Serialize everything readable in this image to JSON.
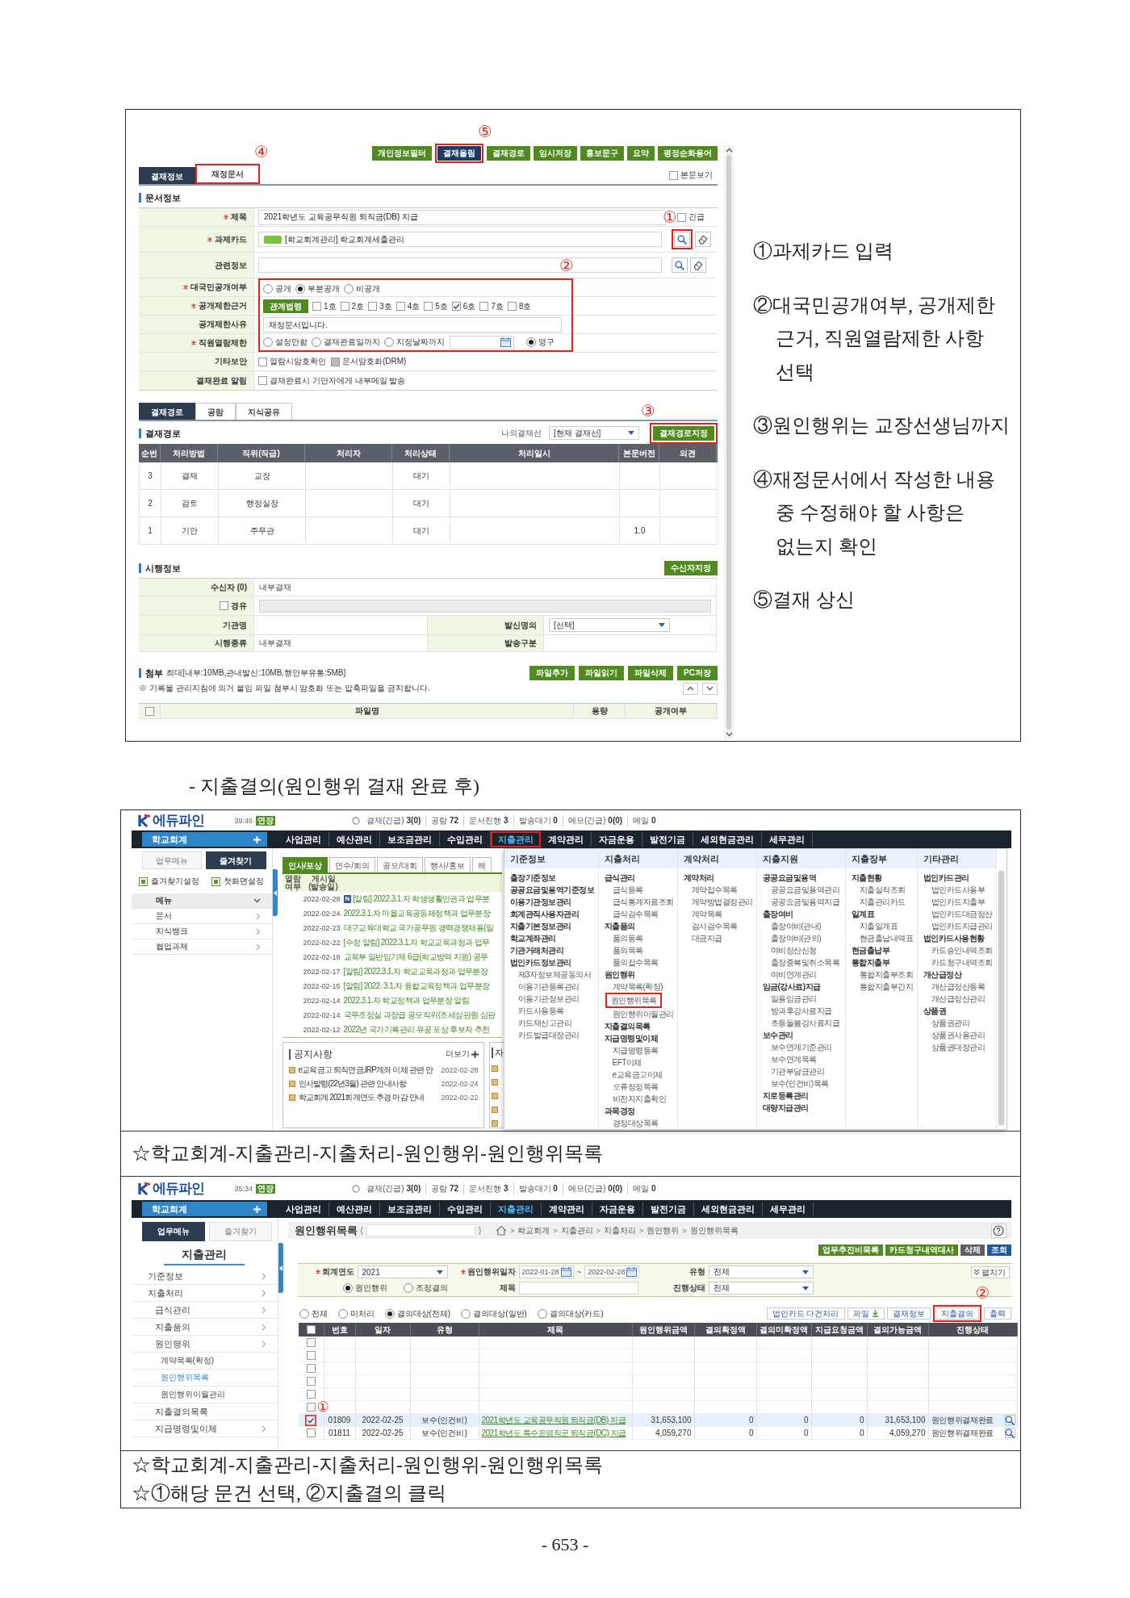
{
  "approval_screen": {
    "toolbar": [
      {
        "label": "개인정보필터",
        "selected": false,
        "highlighted": false
      },
      {
        "label": "결재올림",
        "selected": true,
        "highlighted": true,
        "marker": "⑤"
      },
      {
        "label": "결재경로",
        "selected": false,
        "highlighted": false
      },
      {
        "label": "임시저장",
        "selected": false,
        "highlighted": false
      },
      {
        "label": "홍보문구",
        "selected": false,
        "highlighted": false
      },
      {
        "label": "요약",
        "selected": false,
        "highlighted": false
      },
      {
        "label": "평정순화용어",
        "selected": false,
        "highlighted": false
      }
    ],
    "tabs": [
      {
        "label": "결재정보",
        "selected": true,
        "highlighted": false
      },
      {
        "label": "재정문서",
        "selected": false,
        "highlighted": true,
        "marker": "④"
      }
    ],
    "body_view": {
      "label": "본문보기",
      "checked": false
    },
    "doc_info": {
      "title": "문서정보",
      "rows": [
        {
          "kind": "text",
          "label": "제목",
          "required": true,
          "highlighted": false,
          "value": "2021학년도 교육공무직원 퇴직금(DB) 지급",
          "urgent": {
            "label": "긴급",
            "checked": false
          }
        },
        {
          "kind": "lookup",
          "label": "과제카드",
          "required": true,
          "highlighted": false,
          "tagged": true,
          "value": "[학교회계관리] 학교회계세출관리",
          "search_highlighted": true,
          "marker": "①"
        },
        {
          "kind": "lookup",
          "label": "관련정보",
          "required": false,
          "highlighted": false,
          "tagged": false,
          "search_highlighted": false
        },
        {
          "kind": "radios",
          "label": "대국민공개여부",
          "required": true,
          "highlighted": true,
          "marker": "②",
          "options": [
            {
              "label": "공개",
              "selected": false,
              "date_field": false
            },
            {
              "label": "부분공개",
              "selected": true,
              "date_field": false
            },
            {
              "label": "비공개",
              "selected": false,
              "date_field": false
            }
          ]
        },
        {
          "kind": "checks",
          "label": "공개제한근거",
          "required": true,
          "highlighted": true,
          "button": "관계법령",
          "options": [
            {
              "label": "1호",
              "checked": false,
              "disabled": false
            },
            {
              "label": "2호",
              "checked": false,
              "disabled": false
            },
            {
              "label": "3호",
              "checked": false,
              "disabled": false
            },
            {
              "label": "4호",
              "checked": false,
              "disabled": false
            },
            {
              "label": "5호",
              "checked": false,
              "disabled": false
            },
            {
              "label": "6호",
              "checked": true,
              "disabled": false
            },
            {
              "label": "7호",
              "checked": false,
              "disabled": false
            },
            {
              "label": "8호",
              "checked": false,
              "disabled": false
            }
          ]
        },
        {
          "kind": "input",
          "label": "공개제한사유",
          "required": false,
          "highlighted": true,
          "value": "재정문서입니다."
        },
        {
          "kind": "radios",
          "label": "직원열람제한",
          "required": true,
          "highlighted": true,
          "options": [
            {
              "label": "설정안함",
              "selected": false,
              "date_field": false
            },
            {
              "label": "결재완료일까지",
              "selected": false,
              "date_field": false
            },
            {
              "label": "지정날짜까지",
              "selected": false,
              "date_field": true
            },
            {
              "label": "영구",
              "selected": true,
              "date_field": false
            }
          ]
        },
        {
          "kind": "checks",
          "label": "기타보안",
          "required": false,
          "highlighted": false,
          "options": [
            {
              "label": "열람시암호확인",
              "checked": false,
              "disabled": false
            },
            {
              "label": "문서암호화(DRM)",
              "checked": false,
              "disabled": true
            }
          ]
        },
        {
          "kind": "checks",
          "label": "결재완료 알림",
          "required": false,
          "highlighted": false,
          "options": [
            {
              "label": "결재완료시 기안자에게 내부메일 발송",
              "checked": false,
              "disabled": false
            }
          ]
        }
      ]
    },
    "approval_tabs": [
      {
        "label": "결재경로",
        "selected": true
      },
      {
        "label": "공람",
        "selected": false
      },
      {
        "label": "지식공유",
        "selected": false
      }
    ],
    "approval_line": {
      "title": "결재경로",
      "my_line_label": "나의결재선",
      "my_line_value": "[현재 결재선]",
      "assign_button": {
        "label": "결재경로지정",
        "highlighted": true,
        "marker": "③"
      },
      "columns": [
        "순번",
        "처리방법",
        "직위(직급)",
        "처리자",
        "처리상태",
        "처리일시",
        "본문버전",
        "의견"
      ],
      "rows": [
        [
          "3",
          "결재",
          "교장",
          null,
          "대기",
          null,
          null,
          null
        ],
        [
          "2",
          "검토",
          "행정실장",
          null,
          "대기",
          null,
          null,
          null
        ],
        [
          "1",
          "기안",
          "주무관",
          null,
          "대기",
          null,
          "1.0",
          null
        ]
      ]
    },
    "enforcement": {
      "title": "시행정보",
      "button": "수신자지정",
      "rows": [
        {
          "kind": "single",
          "label": "수신자 (0)",
          "value": "내부결재"
        },
        {
          "kind": "via",
          "label": "경유",
          "checked": false
        },
        {
          "kind": "pair",
          "cells": [
            {
              "label": "기관명"
            },
            {
              "label": "발신명의",
              "select": "[선택]"
            }
          ]
        },
        {
          "kind": "pair",
          "cells": [
            {
              "label": "시행종류",
              "value": "내부결재"
            },
            {
              "label": "발송구분"
            }
          ]
        }
      ]
    },
    "attachments": {
      "title": "첨부",
      "limit": "최대[내부:10MB,관내발신:10MB,행안부유통:5MB]",
      "buttons": [
        "파일추가",
        "파일읽기",
        "파일삭제",
        "PC저장"
      ],
      "notice": "※ 기록물 관리지침에 의거 붙임 파일 첨부시 암호화 또는 압축파일을 금지합니다.",
      "select_all": false,
      "columns": [
        "파일명",
        "용량",
        "공개여부"
      ]
    }
  },
  "approval_notes": [
    "①과제카드 입력",
    "②대국민공개여부, 공개제한\n근거, 직원열람제한 사항\n선택",
    "③원인행위는 교장선생님까지",
    "④재정문서에서 작성한 내용\n중 수정해야 할 사항은\n없는지 확인",
    "⑤결재 상신"
  ],
  "section_caption": "- 지출결의(원인행위 결재 완료 후)",
  "menu_screen": {
    "header": {
      "logo": "에듀파인",
      "time": "39:46",
      "badge": "연장",
      "status": [
        {
          "label": "결재(긴급)",
          "value": "3(0)"
        },
        {
          "label": "공람",
          "value": "72"
        },
        {
          "label": "문서진행",
          "value": "3"
        },
        {
          "label": "발송대기",
          "value": "0"
        },
        {
          "label": "메모(긴급)",
          "value": "0(0)"
        },
        {
          "label": "메일",
          "value": "0"
        }
      ]
    },
    "module": "학교회계",
    "nav": [
      {
        "label": "사업관리",
        "selected": false,
        "highlighted": false
      },
      {
        "label": "예산관리",
        "selected": false,
        "highlighted": false
      },
      {
        "label": "보조금관리",
        "selected": false,
        "highlighted": false
      },
      {
        "label": "수입관리",
        "selected": false,
        "highlighted": false
      },
      {
        "label": "지출관리",
        "selected": true,
        "highlighted": true
      },
      {
        "label": "계약관리",
        "selected": false,
        "highlighted": false
      },
      {
        "label": "자금운용",
        "selected": false,
        "highlighted": false
      },
      {
        "label": "발전기금",
        "selected": false,
        "highlighted": false
      },
      {
        "label": "세외현금관리",
        "selected": false,
        "highlighted": false
      },
      {
        "label": "세무관리",
        "selected": false,
        "highlighted": false
      }
    ],
    "sidebar": {
      "tabs": [
        {
          "label": "업무메뉴",
          "selected": false
        },
        {
          "label": "즐겨찾기",
          "selected": true
        }
      ],
      "shortcuts": [
        "즐겨찾기설정",
        "첫화면설정"
      ],
      "menu": [
        {
          "label": "메뉴",
          "expanded": true
        },
        {
          "label": "문서",
          "expanded": false
        },
        {
          "label": "지식뱅크",
          "expanded": false
        },
        {
          "label": "협업과제",
          "expanded": false
        }
      ]
    },
    "board": {
      "tabs": [
        {
          "label": "인사/포상",
          "selected": true
        },
        {
          "label": "연수/회의",
          "selected": false
        },
        {
          "label": "공모/대회",
          "selected": false
        },
        {
          "label": "행사/홍보",
          "selected": false
        },
        {
          "label": "해",
          "selected": false
        }
      ],
      "columns": [
        "열람 여부",
        "게시일 (발송일)"
      ],
      "rows": [
        {
          "date": "2022-02-28",
          "badge": "N",
          "title": "[알림] 2022.3.1.자 학생생활인권과 업무분"
        },
        {
          "date": "2022-02-24",
          "title": "2022.3.1.자 마을교육공동체정책과 업무분장"
        },
        {
          "date": "2022-02-23",
          "title": "대구교육대학교 국가공무원 경력경쟁채용(일"
        },
        {
          "date": "2022-02-22",
          "title": "[수정 알림] 2022.3.1.자 학교교육과정과 업무"
        },
        {
          "date": "2022-02-18",
          "title": "교육부 일반임기제 6급(학교방역 지원) 공무"
        },
        {
          "date": "2022-02-17",
          "title": "[알림] 2022.3.1.자 학교교육과정과 업무분장"
        },
        {
          "date": "2022-02-15",
          "title": "[알림] 2022. 3.1.자 융합교육정책과 업무분장"
        },
        {
          "date": "2022-02-14",
          "title": "2022.3.1.자 학교정책과 업무분장 알림"
        },
        {
          "date": "2022-02-14",
          "title": "국무조정실 과장급 공모직위(조세심판원 심판"
        },
        {
          "date": "2022-02-12",
          "title": "2022년 국가기록관리 유공 포상 후보자 추천"
        }
      ]
    },
    "notices": {
      "title": "공지사항",
      "more": "더보기",
      "items": [
        {
          "title": "e교육금고 퇴직연금,IRP계좌 이체 관련 안",
          "date": "2022-02-28"
        },
        {
          "title": "인사발령(22년3월) 관련 안내사항",
          "date": "2022-02-24"
        },
        {
          "title": "학교회계 2021회계연도 추경 마감 안내",
          "date": "2022-02-22"
        }
      ]
    },
    "side_panel": {
      "title": "자"
    },
    "mega_menu": {
      "columns": [
        {
          "title": "기준정보",
          "items": [
            {
              "label": "출장기준정보",
              "highlighted": false
            },
            {
              "label": "공공요금및용역기준정보",
              "highlighted": false
            },
            {
              "label": "이용기관정보관리",
              "highlighted": false
            },
            {
              "label": "회계관직사용자관리",
              "highlighted": false
            },
            {
              "label": "지출기본정보관리",
              "highlighted": false
            },
            {
              "label": "학교계좌관리",
              "highlighted": false
            },
            {
              "label": "기관거래처관리",
              "highlighted": false
            },
            {
              "label": "법인카드정보관리",
              "highlighted": false,
              "children": [
                {
                  "label": "제3자정보제공동의서",
                  "highlighted": false
                },
                {
                  "label": "이용기관등록관리",
                  "highlighted": false
                },
                {
                  "label": "이용기관정보관리",
                  "highlighted": false
                },
                {
                  "label": "카드사용등록",
                  "highlighted": false
                },
                {
                  "label": "카드재신고관리",
                  "highlighted": false
                },
                {
                  "label": "카드발급대장관리",
                  "highlighted": false
                }
              ]
            }
          ]
        },
        {
          "title": "지출처리",
          "items": [
            {
              "label": "급식관리",
              "highlighted": false,
              "children": [
                {
                  "label": "급식등록",
                  "highlighted": false
                },
                {
                  "label": "급식통계자료조회",
                  "highlighted": false
                },
                {
                  "label": "급식검수목록",
                  "highlighted": false
                }
              ]
            },
            {
              "label": "지출품의",
              "highlighted": false,
              "children": [
                {
                  "label": "품의등록",
                  "highlighted": false
                },
                {
                  "label": "품의목록",
                  "highlighted": false
                },
                {
                  "label": "품의접수목록",
                  "highlighted": false
                }
              ]
            },
            {
              "label": "원인행위",
              "highlighted": false,
              "children": [
                {
                  "label": "계약목록(확정)",
                  "highlighted": false
                },
                {
                  "label": "원인행위목록",
                  "highlighted": true
                },
                {
                  "label": "원인행위이월관리",
                  "highlighted": false
                }
              ]
            },
            {
              "label": "지출결의목록",
              "highlighted": false
            },
            {
              "label": "지급명령및이체",
              "highlighted": false,
              "children": [
                {
                  "label": "지급명령등록",
                  "highlighted": false
                },
                {
                  "label": "EFT이체",
                  "highlighted": false
                },
                {
                  "label": "e교육금고이체",
                  "highlighted": false
                },
                {
                  "label": "오류정정목록",
                  "highlighted": false
                },
                {
                  "label": "비전자지출확인",
                  "highlighted": false
                }
              ]
            },
            {
              "label": "과목경정",
              "highlighted": false,
              "children": [
                {
                  "label": "경정대상목록",
                  "highlighted": false
                }
              ]
            }
          ]
        },
        {
          "title": "계약처리",
          "items": [
            {
              "label": "계약처리",
              "highlighted": false,
              "children": [
                {
                  "label": "계약접수목록",
                  "highlighted": false
                },
                {
                  "label": "계약방법결정관리",
                  "highlighted": false
                },
                {
                  "label": "계약목록",
                  "highlighted": false
                },
                {
                  "label": "검사검수목록",
                  "highlighted": false
                },
                {
                  "label": "대금지급",
                  "highlighted": false
                }
              ]
            }
          ]
        },
        {
          "title": "지출지원",
          "items": [
            {
              "label": "공공요금및용역",
              "highlighted": false,
              "children": [
                {
                  "label": "공공요금및용역관리",
                  "highlighted": false
                },
                {
                  "label": "공공요금및용역지급",
                  "highlighted": false
                }
              ]
            },
            {
              "label": "출장여비",
              "highlighted": false,
              "children": [
                {
                  "label": "출장여비(관내)",
                  "highlighted": false
                },
                {
                  "label": "출장여비(관외)",
                  "highlighted": false
                },
                {
                  "label": "여비정산신청",
                  "highlighted": false
                },
                {
                  "label": "출장중복및취소목록",
                  "highlighted": false
                },
                {
                  "label": "여비연계관리",
                  "highlighted": false
                }
              ]
            },
            {
              "label": "임금(강사료)지급",
              "highlighted": false,
              "children": [
                {
                  "label": "일용임금관리",
                  "highlighted": false
                },
                {
                  "label": "방과후강사료지급",
                  "highlighted": false
                },
                {
                  "label": "초등돌봄강사료지급",
                  "highlighted": false
                }
              ]
            },
            {
              "label": "보수관리",
              "highlighted": false,
              "children": [
                {
                  "label": "보수연계기준관리",
                  "highlighted": false
                },
                {
                  "label": "보수연계목록",
                  "highlighted": false
                },
                {
                  "label": "기관부담금관리",
                  "highlighted": false
                },
                {
                  "label": "보수(인건비)목록",
                  "highlighted": false
                }
              ]
            },
            {
              "label": "지로등록관리",
              "highlighted": false
            },
            {
              "label": "대량지급관리",
              "highlighted": false
            }
          ]
        },
        {
          "title": "지출장부",
          "items": [
            {
              "label": "지출현황",
              "highlighted": false,
              "children": [
                {
                  "label": "지출실적조회",
                  "highlighted": false
                },
                {
                  "label": "지출관리카드",
                  "highlighted": false
                }
              ]
            },
            {
              "label": "일계표",
              "highlighted": false,
              "children": [
                {
                  "label": "지출일계표",
                  "highlighted": false
                },
                {
                  "label": "현금출납내역표",
                  "highlighted": false
                }
              ]
            },
            {
              "label": "현금출납부",
              "highlighted": false
            },
            {
              "label": "통합지출부",
              "highlighted": false,
              "children": [
                {
                  "label": "통합지출부조회",
                  "highlighted": false
                },
                {
                  "label": "통합지출부간지",
                  "highlighted": false
                }
              ]
            }
          ]
        },
        {
          "title": "기타관리",
          "items": [
            {
              "label": "법인카드관리",
              "highlighted": false,
              "children": [
                {
                  "label": "법인카드사용부",
                  "highlighted": false
                },
                {
                  "label": "법인카드지출부",
                  "highlighted": false
                },
                {
                  "label": "법인카드대금정산",
                  "highlighted": false
                },
                {
                  "label": "법인카드지급관리",
                  "highlighted": false
                }
              ]
            },
            {
              "label": "법인카드사용현황",
              "highlighted": false,
              "children": [
                {
                  "label": "카드승인내역조회",
                  "highlighted": false
                },
                {
                  "label": "카드청구내역조회",
                  "highlighted": false
                }
              ]
            },
            {
              "label": "개산급정산",
              "highlighted": false,
              "children": [
                {
                  "label": "개산급정산등록",
                  "highlighted": false
                },
                {
                  "label": "개산급정산관리",
                  "highlighted": false
                }
              ]
            },
            {
              "label": "상품권",
              "highlighted": false,
              "children": [
                {
                  "label": "상품권관리",
                  "highlighted": false
                },
                {
                  "label": "상품권사용관리",
                  "highlighted": false
                },
                {
                  "label": "상품권대장관리",
                  "highlighted": false
                }
              ]
            }
          ]
        }
      ]
    }
  },
  "menu_screen_caption": "☆학교회계-지출관리-지출처리-원인행위-원인행위목록",
  "list_screen": {
    "header": {
      "logo": "에듀파인",
      "time": "35:34",
      "badge": "연장",
      "status": [
        {
          "label": "결재(긴급)",
          "value": "3(0)"
        },
        {
          "label": "공람",
          "value": "72"
        },
        {
          "label": "문서진행",
          "value": "3"
        },
        {
          "label": "발송대기",
          "value": "0"
        },
        {
          "label": "메모(긴급)",
          "value": "0(0)"
        },
        {
          "label": "메일",
          "value": "0"
        }
      ]
    },
    "module": "학교회계",
    "nav": [
      {
        "label": "사업관리",
        "selected": false,
        "highlighted": false
      },
      {
        "label": "예산관리",
        "selected": false,
        "highlighted": false
      },
      {
        "label": "보조금관리",
        "selected": false,
        "highlighted": false
      },
      {
        "label": "수입관리",
        "selected": false,
        "highlighted": false
      },
      {
        "label": "지출관리",
        "selected": true,
        "highlighted": false
      },
      {
        "label": "계약관리",
        "selected": false,
        "highlighted": false
      },
      {
        "label": "자금운용",
        "selected": false,
        "highlighted": false
      },
      {
        "label": "발전기금",
        "selected": false,
        "highlighted": false
      },
      {
        "label": "세외현금관리",
        "selected": false,
        "highlighted": false
      },
      {
        "label": "세무관리",
        "selected": false,
        "highlighted": false
      }
    ],
    "sidebar": {
      "tabs": [
        {
          "label": "업무메뉴",
          "selected": true
        },
        {
          "label": "즐겨찾기",
          "selected": false
        }
      ],
      "title": "지출관리",
      "menu": [
        {
          "label": "기준정보",
          "expandable": true,
          "selected": false
        },
        {
          "label": "지출처리",
          "expandable": true,
          "selected": false,
          "children": [
            {
              "label": "급식관리",
              "expandable": true,
              "selected": false
            },
            {
              "label": "지출품의",
              "expandable": true,
              "selected": false
            },
            {
              "label": "원인행위",
              "expandable": true,
              "selected": false,
              "children": [
                {
                  "label": "계약목록(확정)",
                  "expandable": false,
                  "selected": false
                },
                {
                  "label": "원인행위목록",
                  "expandable": false,
                  "selected": true
                },
                {
                  "label": "원인행위이월관리",
                  "expandable": false,
                  "selected": false
                }
              ]
            },
            {
              "label": "지출결의목록",
              "expandable": false,
              "selected": false
            },
            {
              "label": "지급명령및이체",
              "expandable": true,
              "selected": false
            }
          ]
        }
      ]
    },
    "page": {
      "title": "원인행위목록",
      "paren_open": "(",
      "paren_close": ")",
      "breadcrumb_separator": ">",
      "breadcrumb": [
        "학교회계",
        "지출관리",
        "지출처리",
        "원인행위",
        "원인행위목록"
      ]
    },
    "actions": [
      {
        "label": "업무추진비목록",
        "kind": "green"
      },
      {
        "label": "카드청구내역대사",
        "kind": "green"
      },
      {
        "label": "삭제",
        "kind": "grey"
      },
      {
        "label": "조회",
        "kind": "blue"
      }
    ],
    "filter": {
      "toggle": "펼치기",
      "cells": [
        {
          "kind": "select",
          "label": "회계연도",
          "required": true,
          "value": "2021"
        },
        {
          "kind": "date_range",
          "label": "원인행위일자",
          "required": true,
          "from": "2022-01-28",
          "separator": "~",
          "to": "2022-02-28"
        },
        {
          "kind": "select",
          "label": "유형",
          "required": false,
          "value": "전체"
        },
        {
          "kind": "radios",
          "options": [
            {
              "label": "원인행위",
              "selected": true
            },
            {
              "label": "조정결의",
              "selected": false
            }
          ]
        },
        {
          "kind": "input",
          "label": "제목",
          "required": false
        },
        {
          "kind": "select",
          "label": "진행상태",
          "required": false,
          "value": "전체"
        }
      ]
    },
    "scope": [
      {
        "label": "전체",
        "selected": false
      },
      {
        "label": "미처리",
        "selected": false
      },
      {
        "label": "결의대상(전체)",
        "selected": true
      },
      {
        "label": "결의대상(일반)",
        "selected": false
      },
      {
        "label": "결의대상(카드)",
        "selected": false
      }
    ],
    "tools": [
      {
        "label": "법인카드 다건처리",
        "icon": false,
        "highlighted": false
      },
      {
        "label": "파일",
        "icon": true,
        "highlighted": false
      },
      {
        "label": "결재정보",
        "icon": false,
        "highlighted": false
      },
      {
        "label": "지출결의",
        "icon": false,
        "highlighted": true,
        "marker": "②"
      },
      {
        "label": "출력",
        "icon": false,
        "highlighted": false
      }
    ],
    "table": {
      "select_all": false,
      "columns": [
        "번호",
        "일자",
        "유형",
        "제목",
        "원인행위금액",
        "결의확정액",
        "결의미확정액",
        "지급요청금액",
        "결의가능금액",
        "진행상태"
      ],
      "rows": [
        {
          "checked": false,
          "selected": false,
          "highlighted": false
        },
        {
          "checked": false,
          "selected": false,
          "highlighted": false
        },
        {
          "checked": false,
          "selected": false,
          "highlighted": false
        },
        {
          "checked": false,
          "selected": false,
          "highlighted": false
        },
        {
          "checked": false,
          "selected": false,
          "highlighted": false
        },
        {
          "checked": false,
          "selected": false,
          "highlighted": false
        },
        {
          "checked": true,
          "selected": true,
          "highlighted": true,
          "marker": "①",
          "cells": [
            "01809",
            "2022-02-25",
            "보수(인건비)",
            "2021학년도 교육공무직원 퇴직금(DB) 지급",
            "31,653,100",
            "0",
            "0",
            "0",
            "31,653,100",
            "원인행위결재완료"
          ]
        },
        {
          "checked": false,
          "selected": false,
          "highlighted": false,
          "cells": [
            "01811",
            "2022-02-25",
            "보수(인건비)",
            "2021학년도 특수운영직군 퇴직금(DC) 지급",
            "4,059,270",
            "0",
            "0",
            "0",
            "4,059,270",
            "원인행위결재완료"
          ]
        }
      ]
    }
  },
  "list_screen_captions": [
    "☆학교회계-지출관리-지출처리-원인행위-원인행위목록",
    "☆①해당 문건 선택, ②지출결의 클릭"
  ],
  "page_number": "- 653 -"
}
